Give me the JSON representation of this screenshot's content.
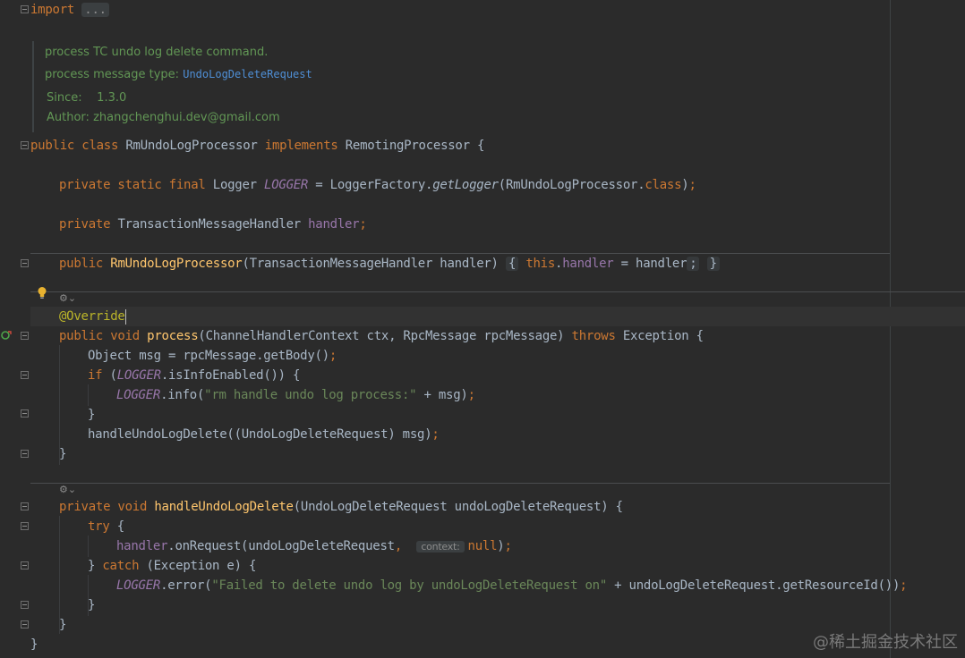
{
  "editor": {
    "language": "java",
    "doc": {
      "description": "process TC undo log delete command.",
      "message_type_label": "process message type:",
      "message_type_link": "UndoLogDeleteRequest",
      "since_label": "Since:",
      "since_value": "1.3.0",
      "author_label": "Author:",
      "author_value": "zhangchenghui.dev@gmail.com"
    },
    "hints": {
      "context_param": "context:"
    },
    "watermark": "@稀土掘金技术社区"
  },
  "colors": {
    "background": "#2b2b2b",
    "keyword": "#cc7832",
    "function": "#ffc66d",
    "field": "#9876aa",
    "string": "#6a8759",
    "annotation": "#bbb529",
    "doc_comment": "#629755",
    "link": "#4f8fd6",
    "default_text": "#a9b7c6"
  },
  "icons": {
    "bulb": "lightbulb-icon",
    "implements": "implements-gutter-icon",
    "inlay": "inlay-hints-icon",
    "fold": "fold-marker-icon"
  },
  "code": {
    "import_kw": "import",
    "import_folded": "...",
    "class_decl": {
      "public": "public",
      "class": "class",
      "name": "RmUndoLogProcessor",
      "implements": "implements",
      "iface": "RemotingProcessor",
      "brace": "{"
    },
    "logger_line": {
      "mods": "private static final",
      "type": "Logger",
      "name": "LOGGER",
      "eq": "=",
      "factory": "LoggerFactory.",
      "method": "getLogger",
      "args_open": "(RmUndoLogProcessor.",
      "class_kw": "class",
      "args_close": ")",
      "semi": ";"
    },
    "handler_field": {
      "mods": "private",
      "type": "TransactionMessageHandler",
      "name": "handler",
      "semi": ";"
    },
    "ctor_line": {
      "public": "public",
      "name": "RmUndoLogProcessor",
      "params": "(TransactionMessageHandler handler)",
      "brace_open": "{",
      "this_kw": "this",
      "dot": ".",
      "field": "handler",
      "assign": " = handler",
      "semi": ";",
      "brace_close": "}"
    },
    "override": "@Override",
    "process_sig": {
      "mods": "public void",
      "name": "process",
      "params": "(ChannelHandlerContext ctx, RpcMessage rpcMessage)",
      "throws": "throws",
      "exc": "Exception",
      "brace": "{"
    },
    "process_body": {
      "l1_decl": "Object msg = rpcMessage.getBody()",
      "l1_semi": ";",
      "l2_if": "if",
      "l2_open": "(",
      "l2_logger": "LOGGER",
      "l2_rest": ".isInfoEnabled()) {",
      "l3_logger": "LOGGER",
      "l3_call": ".info(",
      "l3_str": "\"rm handle undo log process:\"",
      "l3_rest": " + msg)",
      "l3_semi": ";",
      "l4_close": "}",
      "l5_call": "handleUndoLogDelete((UndoLogDeleteRequest) msg)",
      "l5_semi": ";",
      "l6_close": "}"
    },
    "handle_sig": {
      "mods": "private void",
      "name": "handleUndoLogDelete",
      "params": "(UndoLogDeleteRequest undoLogDeleteRequest) {"
    },
    "handle_body": {
      "try_kw": "try",
      "try_brace": " {",
      "handler_field": "handler",
      "on_request": ".onRequest(undoLogDeleteRequest",
      "comma": ",",
      "null_kw": "null",
      "close_call": ")",
      "semi": ";",
      "catch_open": "} ",
      "catch_kw": "catch",
      "catch_rest": " (Exception e) {",
      "err_logger": "LOGGER",
      "err_call": ".error(",
      "err_str": "\"Failed to delete undo log by undoLogDeleteRequest on\"",
      "err_rest": " + undoLogDeleteRequest.getResourceId())",
      "err_semi": ";",
      "inner_close": "}",
      "method_close": "}",
      "class_close": "}"
    }
  }
}
